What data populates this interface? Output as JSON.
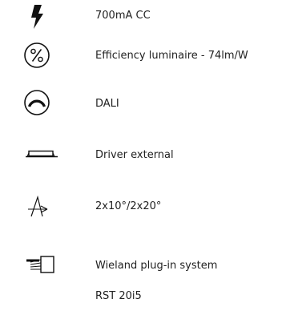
{
  "specs": [
    {
      "icon": "lightning-bolt-icon",
      "label": "700mA CC"
    },
    {
      "icon": "percent-circle-icon",
      "label": "Efficiency luminaire - 74lm/W"
    },
    {
      "icon": "dimming-arc-circle-icon",
      "label": "DALI"
    },
    {
      "icon": "external-driver-icon",
      "label": "Driver external"
    },
    {
      "icon": "beam-angle-icon",
      "label": "2x10°/2x20°"
    },
    {
      "icon": "plug-connector-icon",
      "label": "Wieland plug-in system",
      "sublabel": "RST 20i5"
    }
  ],
  "colors": {
    "text": "#222222",
    "icon": "#111111"
  }
}
